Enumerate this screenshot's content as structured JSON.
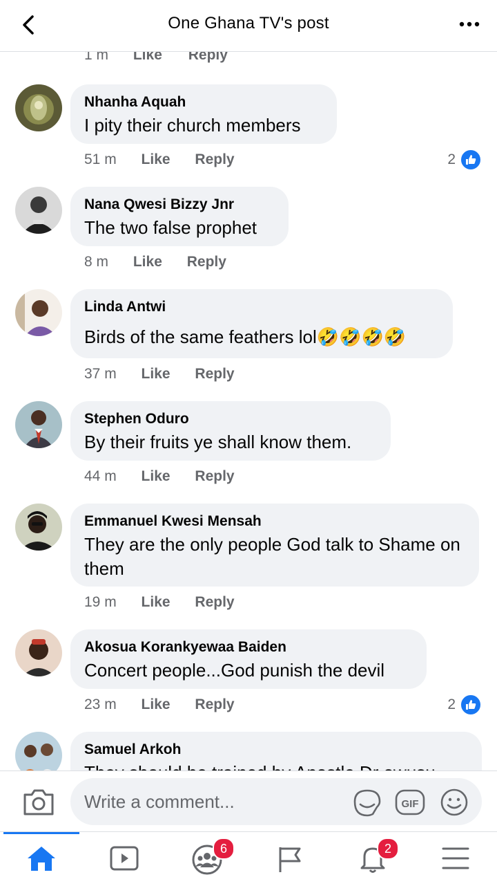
{
  "header": {
    "title": "One Ghana TV's post"
  },
  "top_meta": {
    "time": "1 m",
    "like": "Like",
    "reply": "Reply"
  },
  "comments": [
    {
      "name": "Nhanha Aquah",
      "text": "I pity their church members",
      "time": "51 m",
      "like": "Like",
      "reply": "Reply",
      "reactions": "2"
    },
    {
      "name": "Nana Qwesi Bizzy Jnr",
      "text": "The two false prophet",
      "time": "8 m",
      "like": "Like",
      "reply": "Reply"
    },
    {
      "name": "Linda Antwi",
      "text": "Birds of the same feathers lol🤣🤣🤣🤣",
      "time": "37 m",
      "like": "Like",
      "reply": "Reply"
    },
    {
      "name": "Stephen Oduro",
      "text": "By their fruits ye shall know them.",
      "time": "44 m",
      "like": "Like",
      "reply": "Reply"
    },
    {
      "name": "Emmanuel Kwesi Mensah",
      "text": "They are the only people God talk to Shame on them",
      "time": "19 m",
      "like": "Like",
      "reply": "Reply"
    },
    {
      "name": "Akosua Korankyewaa Baiden",
      "text": "Concert people...God punish the devil",
      "time": "23 m",
      "like": "Like",
      "reply": "Reply",
      "reactions": "2"
    },
    {
      "name": "Samuel Arkoh",
      "text": "They should be trained by Apostle Dr owusu"
    }
  ],
  "composer": {
    "placeholder": "Write a comment..."
  },
  "tabbar": {
    "groups_badge": "6",
    "notifications_badge": "2"
  },
  "colors": {
    "accent": "#1877f2",
    "badge": "#e41e3f",
    "bubble": "#f0f2f5",
    "meta": "#65676b"
  },
  "icons": [
    "back-icon",
    "more-icon",
    "like-icon",
    "camera-icon",
    "sticker-icon",
    "gif-icon",
    "emoji-icon",
    "home-icon",
    "watch-icon",
    "groups-icon",
    "pages-icon",
    "notifications-icon",
    "menu-icon"
  ]
}
